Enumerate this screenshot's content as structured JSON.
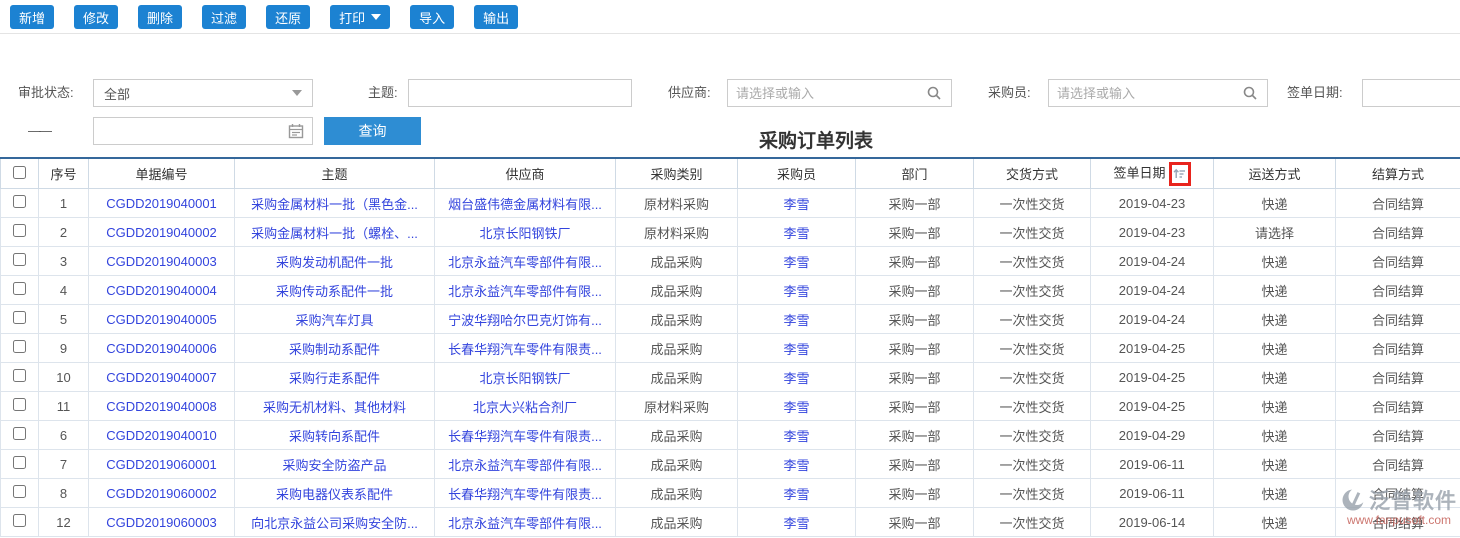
{
  "toolbar": {
    "buttons": [
      {
        "id": "add",
        "label": "新增"
      },
      {
        "id": "edit",
        "label": "修改"
      },
      {
        "id": "delete",
        "label": "删除"
      },
      {
        "id": "filter",
        "label": "过滤"
      },
      {
        "id": "restore",
        "label": "还原"
      },
      {
        "id": "print",
        "label": "打印",
        "has_caret": true
      },
      {
        "id": "import",
        "label": "导入"
      },
      {
        "id": "export",
        "label": "输出"
      }
    ]
  },
  "filters": {
    "approval_status": {
      "label": "审批状态:",
      "value": "全部"
    },
    "subject": {
      "label": "主题:",
      "value": "",
      "placeholder": ""
    },
    "supplier": {
      "label": "供应商:",
      "value": "",
      "placeholder": "请选择或输入"
    },
    "buyer": {
      "label": "采购员:",
      "value": "",
      "placeholder": "请选择或输入"
    },
    "sign_date": {
      "label": "签单日期:",
      "value": ""
    },
    "date_range_separator": "——",
    "end_date_value": "",
    "query_button": "查询"
  },
  "page_title": "采购订单列表",
  "table": {
    "headers": {
      "serial": "序号",
      "doc_no": "单据编号",
      "subject": "主题",
      "supplier": "供应商",
      "category": "采购类别",
      "buyer": "采购员",
      "department": "部门",
      "delivery": "交货方式",
      "sign_date": "签单日期",
      "transport": "运送方式",
      "settlement": "结算方式"
    },
    "rows": [
      {
        "serial": "1",
        "doc_no": "CGDD2019040001",
        "subject": "采购金属材料一批（黑色金...",
        "supplier": "烟台盛伟德金属材料有限...",
        "category": "原材料采购",
        "buyer": "李雪",
        "department": "采购一部",
        "delivery": "一次性交货",
        "sign_date": "2019-04-23",
        "transport": "快递",
        "settlement": "合同结算"
      },
      {
        "serial": "2",
        "doc_no": "CGDD2019040002",
        "subject": "采购金属材料一批（螺栓、...",
        "supplier": "北京长阳钢铁厂",
        "category": "原材料采购",
        "buyer": "李雪",
        "department": "采购一部",
        "delivery": "一次性交货",
        "sign_date": "2019-04-23",
        "transport": "请选择",
        "settlement": "合同结算"
      },
      {
        "serial": "3",
        "doc_no": "CGDD2019040003",
        "subject": "采购发动机配件一批",
        "supplier": "北京永益汽车零部件有限...",
        "category": "成品采购",
        "buyer": "李雪",
        "department": "采购一部",
        "delivery": "一次性交货",
        "sign_date": "2019-04-24",
        "transport": "快递",
        "settlement": "合同结算"
      },
      {
        "serial": "4",
        "doc_no": "CGDD2019040004",
        "subject": "采购传动系配件一批",
        "supplier": "北京永益汽车零部件有限...",
        "category": "成品采购",
        "buyer": "李雪",
        "department": "采购一部",
        "delivery": "一次性交货",
        "sign_date": "2019-04-24",
        "transport": "快递",
        "settlement": "合同结算"
      },
      {
        "serial": "5",
        "doc_no": "CGDD2019040005",
        "subject": "采购汽车灯具",
        "supplier": "宁波华翔哈尔巴克灯饰有...",
        "category": "成品采购",
        "buyer": "李雪",
        "department": "采购一部",
        "delivery": "一次性交货",
        "sign_date": "2019-04-24",
        "transport": "快递",
        "settlement": "合同结算"
      },
      {
        "serial": "9",
        "doc_no": "CGDD2019040006",
        "subject": "采购制动系配件",
        "supplier": "长春华翔汽车零件有限责...",
        "category": "成品采购",
        "buyer": "李雪",
        "department": "采购一部",
        "delivery": "一次性交货",
        "sign_date": "2019-04-25",
        "transport": "快递",
        "settlement": "合同结算"
      },
      {
        "serial": "10",
        "doc_no": "CGDD2019040007",
        "subject": "采购行走系配件",
        "supplier": "北京长阳钢铁厂",
        "category": "成品采购",
        "buyer": "李雪",
        "department": "采购一部",
        "delivery": "一次性交货",
        "sign_date": "2019-04-25",
        "transport": "快递",
        "settlement": "合同结算"
      },
      {
        "serial": "11",
        "doc_no": "CGDD2019040008",
        "subject": "采购无机材料、其他材料",
        "supplier": "北京大兴粘合剂厂",
        "category": "原材料采购",
        "buyer": "李雪",
        "department": "采购一部",
        "delivery": "一次性交货",
        "sign_date": "2019-04-25",
        "transport": "快递",
        "settlement": "合同结算"
      },
      {
        "serial": "6",
        "doc_no": "CGDD2019040010",
        "subject": "采购转向系配件",
        "supplier": "长春华翔汽车零件有限责...",
        "category": "成品采购",
        "buyer": "李雪",
        "department": "采购一部",
        "delivery": "一次性交货",
        "sign_date": "2019-04-29",
        "transport": "快递",
        "settlement": "合同结算"
      },
      {
        "serial": "7",
        "doc_no": "CGDD2019060001",
        "subject": "采购安全防盗产品",
        "supplier": "北京永益汽车零部件有限...",
        "category": "成品采购",
        "buyer": "李雪",
        "department": "采购一部",
        "delivery": "一次性交货",
        "sign_date": "2019-06-11",
        "transport": "快递",
        "settlement": "合同结算"
      },
      {
        "serial": "8",
        "doc_no": "CGDD2019060002",
        "subject": "采购电器仪表系配件",
        "supplier": "长春华翔汽车零件有限责...",
        "category": "成品采购",
        "buyer": "李雪",
        "department": "采购一部",
        "delivery": "一次性交货",
        "sign_date": "2019-06-11",
        "transport": "快递",
        "settlement": "合同结算"
      },
      {
        "serial": "12",
        "doc_no": "CGDD2019060003",
        "subject": "向北京永益公司采购安全防...",
        "supplier": "北京永益汽车零部件有限...",
        "category": "成品采购",
        "buyer": "李雪",
        "department": "采购一部",
        "delivery": "一次性交货",
        "sign_date": "2019-06-14",
        "transport": "快递",
        "settlement": "合同结算"
      }
    ]
  },
  "watermark": {
    "brand": "泛普软件",
    "url": "www.fanpusoft.com"
  },
  "icons": {
    "sort": "sort-icon",
    "search": "search-icon",
    "calendar": "calendar-icon"
  },
  "colors": {
    "accent_blue": "#1c82d2",
    "query_blue": "#2e8dd3",
    "link_blue": "#3344dd",
    "annotation_red": "#e8241d",
    "header_border_blue": "#35689b"
  }
}
